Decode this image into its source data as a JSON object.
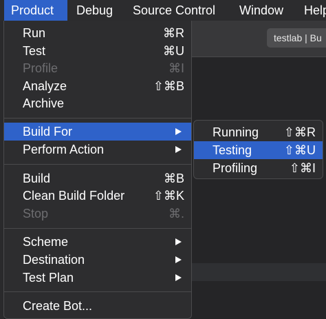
{
  "menubar": {
    "items": [
      "Product",
      "Debug",
      "Source Control",
      "Window",
      "Help"
    ]
  },
  "window": {
    "tab_title": "testlab | Bu"
  },
  "product_menu": {
    "items": [
      {
        "label": "Run",
        "shortcut": "⌘R",
        "enabled": true
      },
      {
        "label": "Test",
        "shortcut": "⌘U",
        "enabled": true
      },
      {
        "label": "Profile",
        "shortcut": "⌘I",
        "enabled": false
      },
      {
        "label": "Analyze",
        "shortcut": "⇧⌘B",
        "enabled": true
      },
      {
        "label": "Archive",
        "shortcut": "",
        "enabled": true
      },
      {
        "label": "Build For",
        "submenu": true,
        "highlighted": true
      },
      {
        "label": "Perform Action",
        "submenu": true
      },
      {
        "label": "Build",
        "shortcut": "⌘B",
        "enabled": true
      },
      {
        "label": "Clean Build Folder",
        "shortcut": "⇧⌘K",
        "enabled": true
      },
      {
        "label": "Stop",
        "shortcut": "⌘.",
        "enabled": false
      },
      {
        "label": "Scheme",
        "submenu": true
      },
      {
        "label": "Destination",
        "submenu": true
      },
      {
        "label": "Test Plan",
        "submenu": true
      },
      {
        "label": "Create Bot...",
        "shortcut": ""
      }
    ]
  },
  "build_for_submenu": {
    "items": [
      {
        "label": "Running",
        "shortcut": "⇧⌘R"
      },
      {
        "label": "Testing",
        "shortcut": "⇧⌘U",
        "highlighted": true
      },
      {
        "label": "Profiling",
        "shortcut": "⇧⌘I"
      }
    ]
  },
  "colors": {
    "highlight": "#2f62c9",
    "menu_bg": "#2d2d2f",
    "disabled_text": "#6d6d70"
  }
}
